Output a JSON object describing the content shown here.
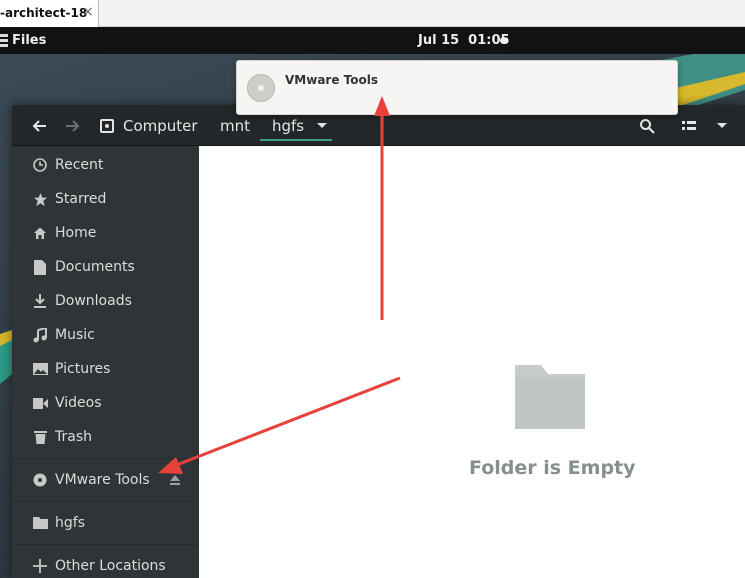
{
  "vm_tab": {
    "title": "-architect-18",
    "close_glyph": "×"
  },
  "topbar": {
    "app_name": "Files",
    "date": "Jul 15",
    "time": "01:05"
  },
  "notification": {
    "title": "VMware Tools",
    "icon": "optical-disc-icon"
  },
  "toolbar": {
    "back_icon": "arrow-left-icon",
    "forward_icon": "arrow-right-icon",
    "breadcrumb": [
      "Computer",
      "mnt",
      "hgfs"
    ],
    "search_icon": "search-icon",
    "view_icon": "view-options-icon",
    "menu_icon": "chevron-down-icon"
  },
  "sidebar": {
    "items": [
      {
        "label": "Recent",
        "icon": "clock-icon"
      },
      {
        "label": "Starred",
        "icon": "star-icon"
      },
      {
        "label": "Home",
        "icon": "home-icon"
      },
      {
        "label": "Documents",
        "icon": "document-icon"
      },
      {
        "label": "Downloads",
        "icon": "download-icon"
      },
      {
        "label": "Music",
        "icon": "music-icon"
      },
      {
        "label": "Pictures",
        "icon": "picture-icon"
      },
      {
        "label": "Videos",
        "icon": "video-icon"
      },
      {
        "label": "Trash",
        "icon": "trash-icon"
      }
    ],
    "devices": [
      {
        "label": "VMware Tools",
        "icon": "optical-disc-icon",
        "eject_icon": "eject-icon"
      }
    ],
    "bookmarks": [
      {
        "label": "hgfs",
        "icon": "folder-icon"
      }
    ],
    "other": {
      "label": "Other Locations",
      "icon": "plus-icon"
    }
  },
  "main": {
    "empty_message": "Folder is Empty",
    "empty_icon": "folder-icon"
  },
  "colors": {
    "accent": "#3a9e8b",
    "annotation": "#e8403a",
    "sidebar_bg": "#2f3537",
    "headerbar_bg": "#232729"
  }
}
